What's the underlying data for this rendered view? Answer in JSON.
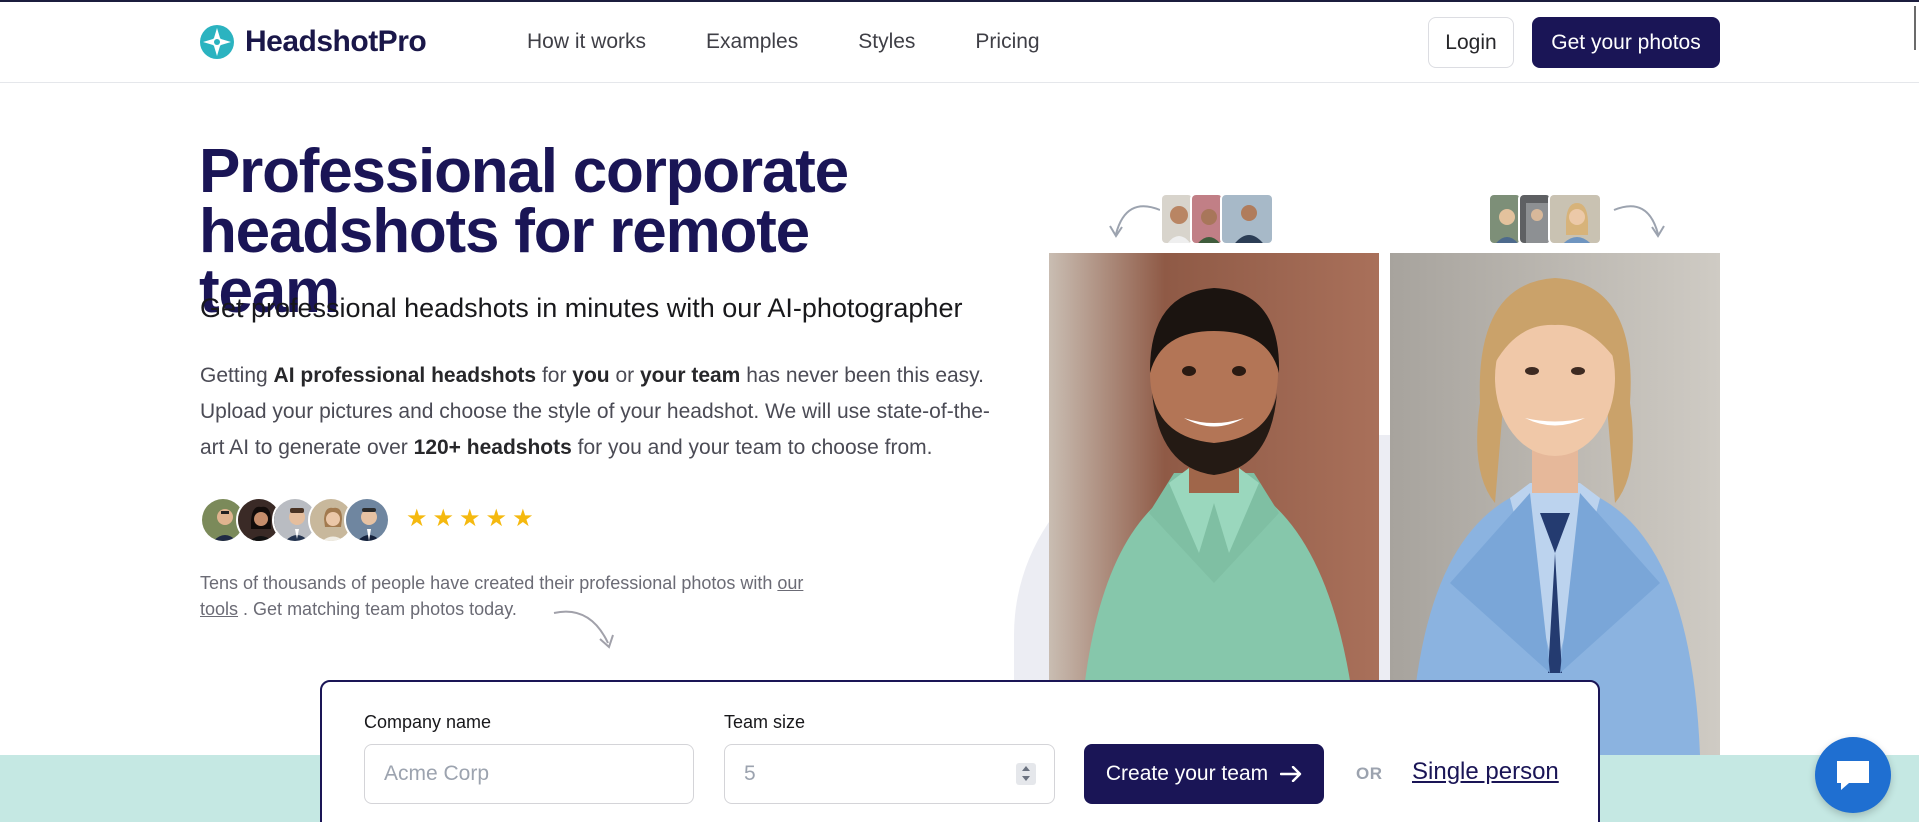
{
  "header": {
    "logo_text": "HeadshotPro",
    "nav": [
      "How it works",
      "Examples",
      "Styles",
      "Pricing"
    ],
    "login_label": "Login",
    "cta_label": "Get your photos"
  },
  "hero": {
    "title": "Professional corporate headshots for remote team",
    "subtitle": "Get professional headshots in minutes with our AI-photographer",
    "description": {
      "p1": "Getting ",
      "b1": "AI professional headshots",
      "p2": " for ",
      "b2": "you",
      "p3": " or ",
      "b3": "your team",
      "p4": " has never been this easy. Upload your pictures and choose the style of your headshot. We will use state-of-the-art AI to generate over ",
      "b4": "120+ headshots",
      "p5": " for you and your team to choose from."
    },
    "rating": {
      "stars": 5
    },
    "social_proof": {
      "before": "Tens of thousands of people have created their professional photos with ",
      "link": "our tools",
      "after": ". Get matching team photos today."
    }
  },
  "form": {
    "company_label": "Company name",
    "company_placeholder": "Acme Corp",
    "team_label": "Team size",
    "team_placeholder": "5",
    "create_label": "Create your team",
    "or_label": "OR",
    "single_label": "Single person"
  },
  "colors": {
    "brand": "#1a1556",
    "star": "#f5b90f",
    "band": "#c5e8e3",
    "chat": "#1f6fd1"
  },
  "icons": [
    "logo-mark-icon",
    "star-icon",
    "arrow-right-icon",
    "chat-icon",
    "curved-arrow-icon"
  ]
}
